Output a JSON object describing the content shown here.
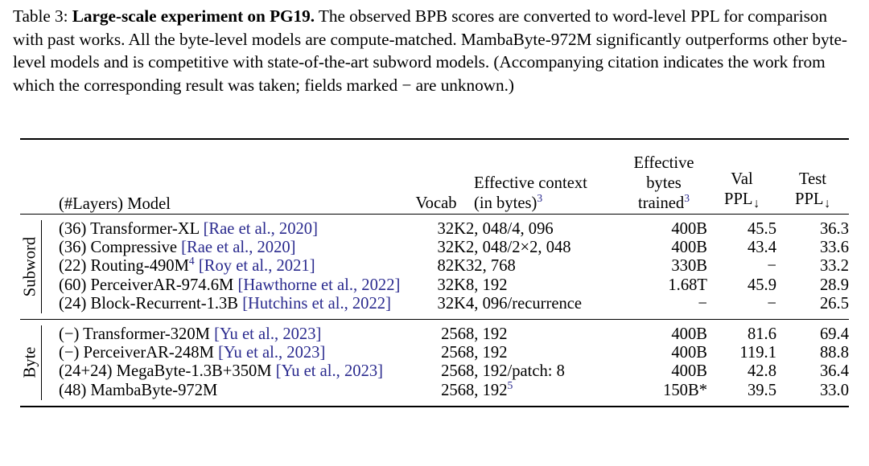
{
  "caption": {
    "label": "Table 3:",
    "bold_title": "Large-scale experiment on PG19.",
    "body": " The observed BPB scores are converted to word-level PPL for comparison with past works. All the byte-level models are compute-matched. MambaByte-972M significantly outperforms other byte-level models and is competitive with state-of-the-art subword models. (Accompanying citation indicates the work from which the corresponding result was taken; fields marked − are unknown.)"
  },
  "table": {
    "headers": {
      "model": "(#Layers) Model",
      "vocab": "Vocab",
      "context_line1": "Effective context",
      "context_line2": "(in bytes)",
      "context_sup": "3",
      "bytes_line1": "Effective",
      "bytes_line2": "bytes",
      "bytes_line3": "trained",
      "bytes_sup": "3",
      "val_line1": "Val",
      "val_line2": "PPL",
      "val_arrow": "↓",
      "test_line1": "Test",
      "test_line2": "PPL",
      "test_arrow": "↓"
    },
    "groups": [
      {
        "name": "Subword",
        "rows": [
          {
            "layers": "(36) ",
            "model": "Transformer-XL ",
            "cite": "[Rae et al., 2020]",
            "sup": "",
            "vocab": "32K",
            "context": "2, 048/4, 096",
            "context_sup": "",
            "bytes": "400B",
            "val": "45.5",
            "val_bold": false,
            "test": "36.3",
            "test_bold": false
          },
          {
            "layers": "(36) ",
            "model": "Compressive ",
            "cite": "[Rae et al., 2020]",
            "sup": "",
            "vocab": "32K",
            "context": "2, 048/2×2, 048",
            "context_sup": "",
            "bytes": "400B",
            "val": "43.4",
            "val_bold": false,
            "test": "33.6",
            "test_bold": false
          },
          {
            "layers": "(22) ",
            "model": "Routing-490M",
            "cite": " [Roy et al., 2021]",
            "sup": "4",
            "vocab": "82K",
            "context": "32, 768",
            "context_sup": "",
            "bytes": "330B",
            "val": "−",
            "val_bold": false,
            "test": "33.2",
            "test_bold": false
          },
          {
            "layers": "(60) ",
            "model": "PerceiverAR-974.6M ",
            "cite": "[Hawthorne et al., 2022]",
            "sup": "",
            "vocab": "32K",
            "context": "8, 192",
            "context_sup": "",
            "bytes": "1.68T",
            "val": "45.9",
            "val_bold": false,
            "test": "28.9",
            "test_bold": false
          },
          {
            "layers": "(24) ",
            "model": "Block-Recurrent-1.3B ",
            "cite": "[Hutchins et al., 2022]",
            "sup": "",
            "vocab": "32K",
            "context": "4, 096/recurrence",
            "context_sup": "",
            "bytes": "−",
            "val": "−",
            "val_bold": false,
            "test": "26.5",
            "test_bold": true
          }
        ]
      },
      {
        "name": "Byte",
        "rows": [
          {
            "layers": "(−) ",
            "model": "Transformer-320M ",
            "cite": "[Yu et al., 2023]",
            "sup": "",
            "vocab": "256",
            "context": "8, 192",
            "context_sup": "",
            "bytes": "400B",
            "val": "81.6",
            "val_bold": false,
            "test": "69.4",
            "test_bold": false
          },
          {
            "layers": "(−) ",
            "model": "PerceiverAR-248M ",
            "cite": "[Yu et al., 2023]",
            "sup": "",
            "vocab": "256",
            "context": "8, 192",
            "context_sup": "",
            "bytes": "400B",
            "val": "119.1",
            "val_bold": false,
            "test": "88.8",
            "test_bold": false
          },
          {
            "layers": "(24+24) ",
            "model": "MegaByte-1.3B+350M ",
            "cite": "[Yu et al., 2023]",
            "sup": "",
            "vocab": "256",
            "context": "8, 192/patch: 8",
            "context_sup": "",
            "bytes": "400B",
            "val": "42.8",
            "val_bold": false,
            "test": "36.4",
            "test_bold": false
          },
          {
            "layers": "(48) ",
            "model": "MambaByte-972M",
            "cite": "",
            "sup": "",
            "vocab": "256",
            "context": "8, 192",
            "context_sup": "5",
            "bytes": "150B*",
            "val": "39.5",
            "val_bold": true,
            "test": "33.0",
            "test_bold": false
          }
        ]
      }
    ]
  },
  "colors": {
    "citation_blue": "#2a2a8e",
    "text_black": "#000000",
    "background": "#ffffff"
  }
}
